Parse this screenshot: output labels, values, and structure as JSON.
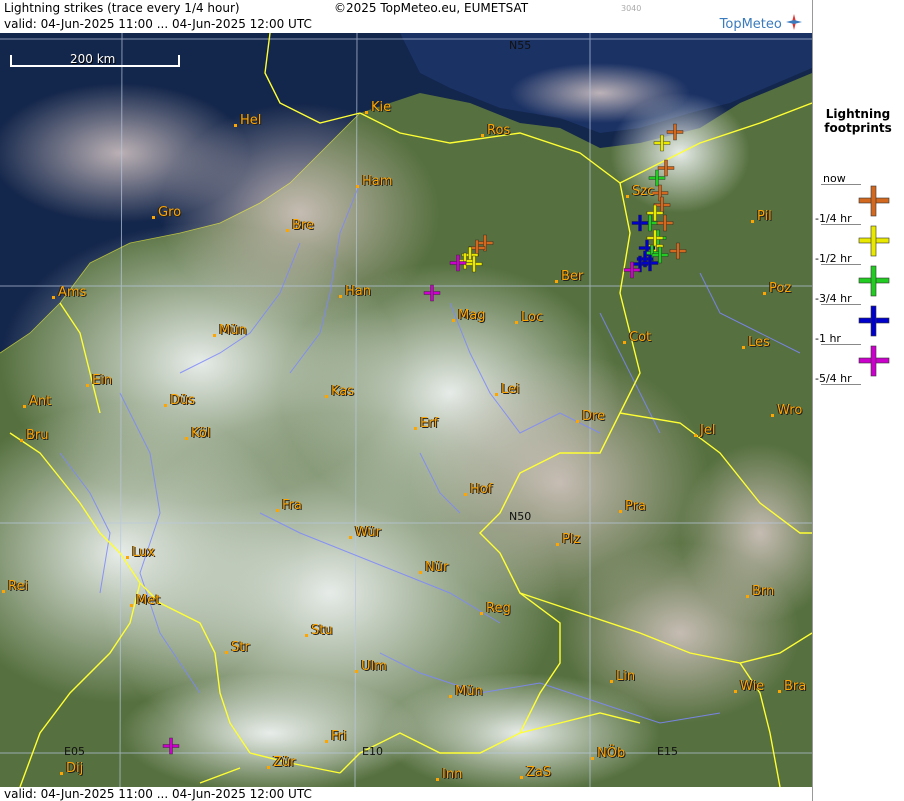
{
  "header": {
    "title": "Lightning strikes (trace every 1/4 hour)",
    "copyright": "©2025 TopMeteo.eu, EUMETSAT",
    "valid": "valid:  04-Jun-2025 11:00 ... 04-Jun-2025 12:00 UTC",
    "code": "3040",
    "logo_text": "TopMeteo"
  },
  "footer": {
    "valid": "valid:  04-Jun-2025 11:00 ... 04-Jun-2025 12:00 UTC"
  },
  "scale_bar": {
    "label": "200 km"
  },
  "grid_labels": [
    {
      "id": "n55",
      "text": "N55"
    },
    {
      "id": "n50",
      "text": "N50"
    },
    {
      "id": "e05",
      "text": "E05"
    },
    {
      "id": "e10",
      "text": "E10"
    },
    {
      "id": "e15",
      "text": "E15"
    }
  ],
  "cities": [
    {
      "name": "Hel"
    },
    {
      "name": "Kie"
    },
    {
      "name": "Ros"
    },
    {
      "name": "Ham"
    },
    {
      "name": "Szc"
    },
    {
      "name": "Gro"
    },
    {
      "name": "Bre"
    },
    {
      "name": "Pil"
    },
    {
      "name": "Ber"
    },
    {
      "name": "Ams"
    },
    {
      "name": "Han"
    },
    {
      "name": "Poz"
    },
    {
      "name": "Mag"
    },
    {
      "name": "Loc"
    },
    {
      "name": "Mün"
    },
    {
      "name": "Cot"
    },
    {
      "name": "Les"
    },
    {
      "name": "Ein"
    },
    {
      "name": "Kas"
    },
    {
      "name": "Lei"
    },
    {
      "name": "Ant"
    },
    {
      "name": "Düs"
    },
    {
      "name": "Wro"
    },
    {
      "name": "Dre"
    },
    {
      "name": "Bru"
    },
    {
      "name": "Köl"
    },
    {
      "name": "Erf"
    },
    {
      "name": "Jel"
    },
    {
      "name": "Hof"
    },
    {
      "name": "Fra"
    },
    {
      "name": "Pra"
    },
    {
      "name": "Wür"
    },
    {
      "name": "Plz"
    },
    {
      "name": "Lux"
    },
    {
      "name": "Rei"
    },
    {
      "name": "Nür"
    },
    {
      "name": "Met"
    },
    {
      "name": "Brn"
    },
    {
      "name": "Reg"
    },
    {
      "name": "Stu"
    },
    {
      "name": "Str"
    },
    {
      "name": "Ulm"
    },
    {
      "name": "Lin"
    },
    {
      "name": "Mün"
    },
    {
      "name": "Wie"
    },
    {
      "name": "Bra"
    },
    {
      "name": "Fri"
    },
    {
      "name": "Dij"
    },
    {
      "name": "Zür"
    },
    {
      "name": "Inn"
    },
    {
      "name": "ZaS"
    },
    {
      "name": "NÖb"
    }
  ],
  "legend": {
    "title": "Lightning footprints",
    "steps": [
      {
        "label": "now",
        "color": "#d2691e"
      },
      {
        "label": "-1/4 hr",
        "color": "#e8e800"
      },
      {
        "label": "-1/2 hr",
        "color": "#22cc22"
      },
      {
        "label": "-3/4 hr",
        "color": "#0000cc"
      },
      {
        "label": "-1 hr",
        "color": "#cc00cc"
      },
      {
        "label": "-5/4 hr",
        "color": ""
      }
    ]
  },
  "colors": {
    "border": "#ffff33",
    "river": "#7d87ff",
    "city": "#ffa500",
    "sea": "#12254a",
    "land": "#4e6b3a",
    "cloud": "#e6eceb"
  }
}
